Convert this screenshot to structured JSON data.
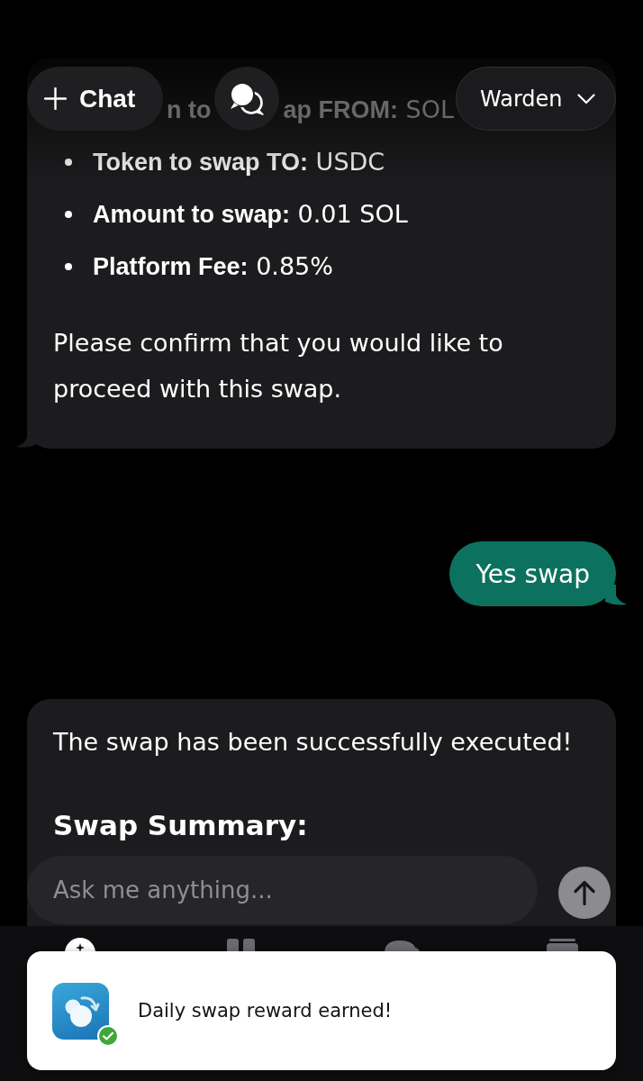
{
  "header": {
    "new_chat_button": {
      "label": "Chat"
    },
    "agent_selector": {
      "label": "Warden"
    }
  },
  "messages": [
    {
      "kind": "assistant",
      "covered_line": {
        "label_fragments": [
          "n to",
          "ap FROM:"
        ],
        "value": "SOL"
      },
      "items": [
        {
          "label": "Token to swap TO:",
          "value": "USDC"
        },
        {
          "label": "Amount to swap:",
          "value": "0.01 SOL"
        },
        {
          "label": "Platform Fee:",
          "value": "0.85%"
        }
      ],
      "paragraphs": [
        "Please confirm that you would like to proceed with this swap."
      ]
    },
    {
      "kind": "user",
      "text": "Yes swap"
    },
    {
      "kind": "assistant",
      "paragraphs": [
        "The swap has been successfully executed!"
      ],
      "heading": "Swap Summary:"
    }
  ],
  "composer": {
    "placeholder": "Ask me anything..."
  },
  "bottom_nav": [
    {
      "selected": true
    },
    {
      "selected": false
    },
    {
      "selected": false
    },
    {
      "selected": false
    }
  ],
  "toast": {
    "message": "Daily swap reward earned!"
  }
}
